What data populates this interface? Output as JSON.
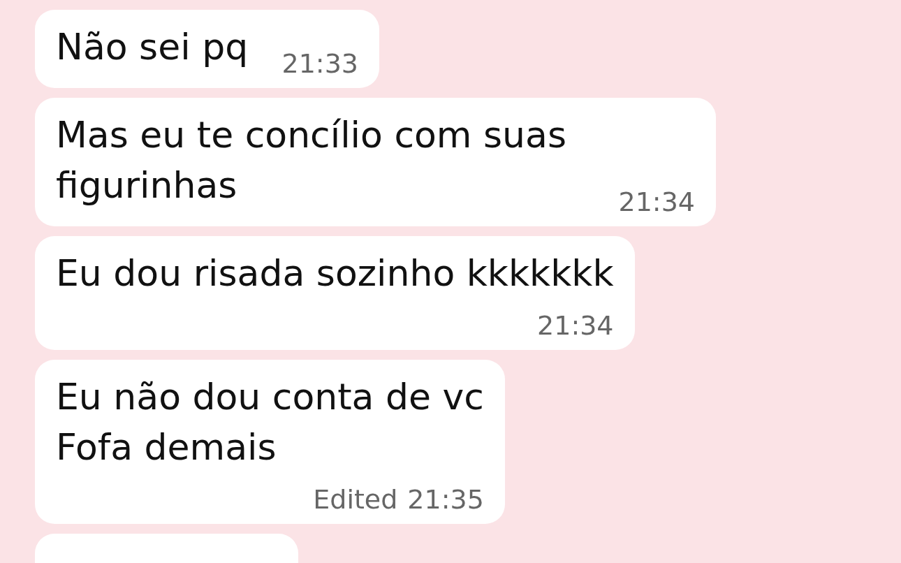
{
  "messages": [
    {
      "kind": "text",
      "text": "Não sei pq",
      "time": "21:33"
    },
    {
      "kind": "text",
      "text": "Mas eu te concílio com suas figurinhas",
      "time": "21:34"
    },
    {
      "kind": "text",
      "text": "Eu dou risada sozinho kkkkkkk",
      "time": "21:34"
    },
    {
      "kind": "text",
      "text": "Eu não dou conta de vc\nFofa demais",
      "edited_label": "Edited",
      "time": "21:35"
    },
    {
      "kind": "partial"
    }
  ]
}
